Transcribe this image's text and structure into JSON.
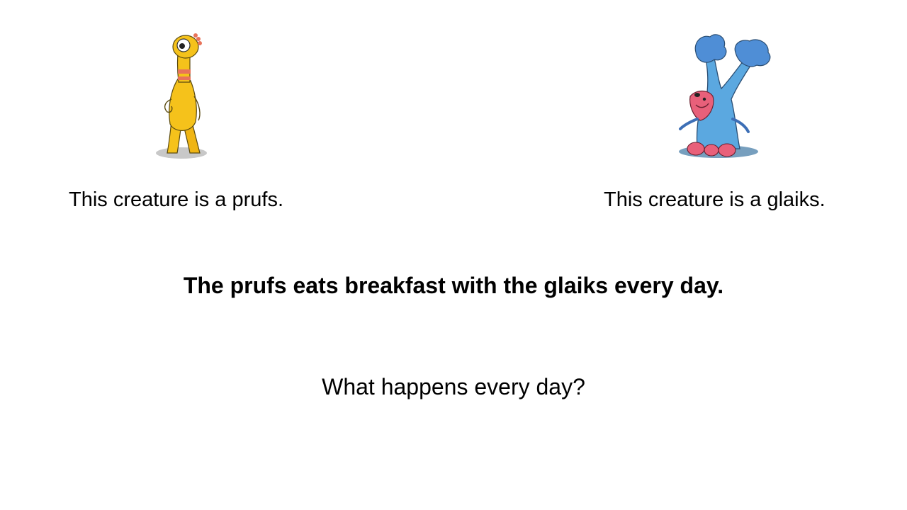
{
  "slide": {
    "left_caption": "This creature is a prufs.",
    "right_caption": "This creature is a glaiks.",
    "statement": "The prufs eats breakfast with the glaiks every day.",
    "question": "What happens every day?"
  },
  "figures": {
    "left": {
      "icon": "yellow-long-neck-creature-illustration",
      "body_color": "#F5C21B",
      "accent_color": "#E8735A"
    },
    "right": {
      "icon": "blue-tree-creature-illustration",
      "body_color": "#5BA8E0",
      "accent_color": "#E8607A"
    }
  }
}
